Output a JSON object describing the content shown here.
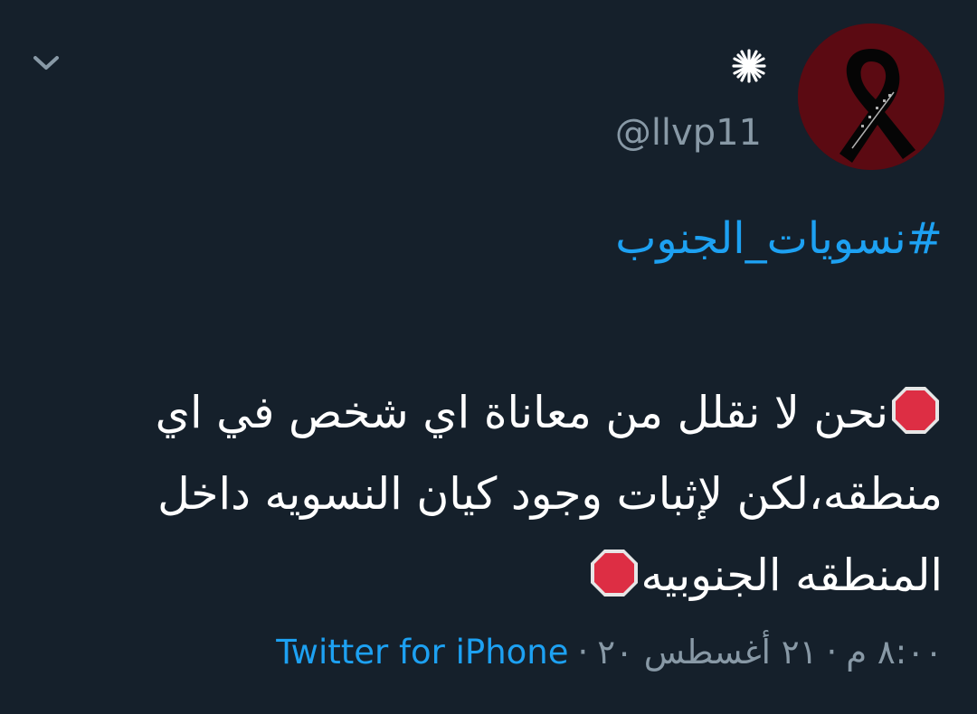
{
  "tweet": {
    "handle": "@llvp11",
    "hashtag": "#نسويات_الجنوب",
    "text_part1": "نحن لا نقلل من معاناة اي شخص في اي منطقه،لكن لإثبات وجود كيان النسويه داخل المنطقه الجنوبيه",
    "time": "٨:٠٠ م",
    "date": "٢١ أغسطس ٢٠",
    "separator": "·",
    "source": "Twitter for iPhone"
  },
  "icons": {
    "menu": "chevron-down-icon",
    "badge": "sparkle-badge-icon",
    "emoji": "stop-sign-emoji"
  },
  "colors": {
    "background": "#15202b",
    "link": "#1da1f2",
    "secondary_text": "#8899a6",
    "primary_text": "#ffffff",
    "stop_sign": "#dd2e44"
  }
}
